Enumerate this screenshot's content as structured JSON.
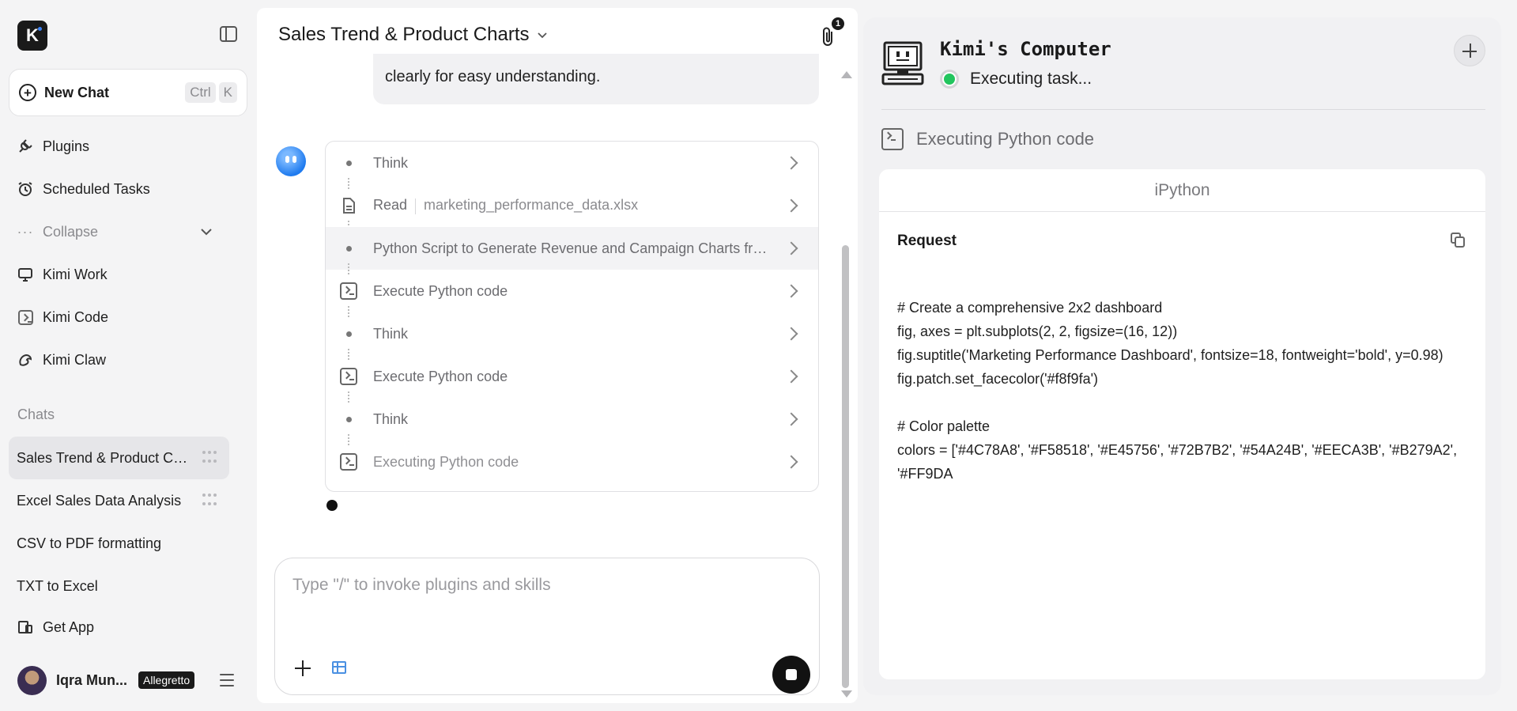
{
  "sidebar": {
    "logo_letter": "K",
    "new_chat": {
      "label": "New Chat",
      "key1": "Ctrl",
      "key2": "K"
    },
    "nav": {
      "plugins": "Plugins",
      "scheduled": "Scheduled Tasks",
      "collapse": "Collapse",
      "kimi_work": "Kimi Work",
      "kimi_code": "Kimi Code",
      "kimi_claw": "Kimi Claw"
    },
    "chats_heading": "Chats",
    "chats": [
      "Sales Trend & Product Charts",
      "Excel Sales Data Analysis",
      "CSV to PDF formatting",
      "TXT to Excel"
    ],
    "get_app": "Get App",
    "user": {
      "name": "Iqra Mun...",
      "plan": "Allegretto"
    }
  },
  "chat": {
    "title": "Sales Trend & Product Charts",
    "attachments_count": "1",
    "user_message_tail": "clearly for easy understanding.",
    "steps": [
      {
        "type": "think",
        "label": "Think"
      },
      {
        "type": "read",
        "label": "Read",
        "file": "marketing_performance_data.xlsx"
      },
      {
        "type": "think",
        "label": "Python Script to Generate Revenue and Campaign Charts from Excel Data"
      },
      {
        "type": "code",
        "label": "Execute Python code"
      },
      {
        "type": "think",
        "label": "Think"
      },
      {
        "type": "code",
        "label": "Execute Python code"
      },
      {
        "type": "think",
        "label": "Think"
      },
      {
        "type": "code",
        "label": "Executing Python code"
      }
    ],
    "composer_placeholder": "Type \"/\" to invoke plugins and skills"
  },
  "computer": {
    "title": "Kimi's Computer",
    "status": "Executing task...",
    "status_color": "#22c55e",
    "exec_label": "Executing Python code",
    "panel_title": "iPython",
    "request_label": "Request",
    "code_lines": [
      "# Create a comprehensive 2x2 dashboard",
      "fig, axes = plt.subplots(2, 2, figsize=(16, 12))",
      "fig.suptitle('Marketing Performance Dashboard', fontsize=18, fontweight='bold', y=0.98)",
      "fig.patch.set_facecolor('#f8f9fa')",
      "",
      "# Color palette",
      "colors = ['#4C78A8', '#F58518', '#E45756', '#72B7B2', '#54A24B', '#EECA3B', '#B279A2', '#FF9DA"
    ]
  }
}
